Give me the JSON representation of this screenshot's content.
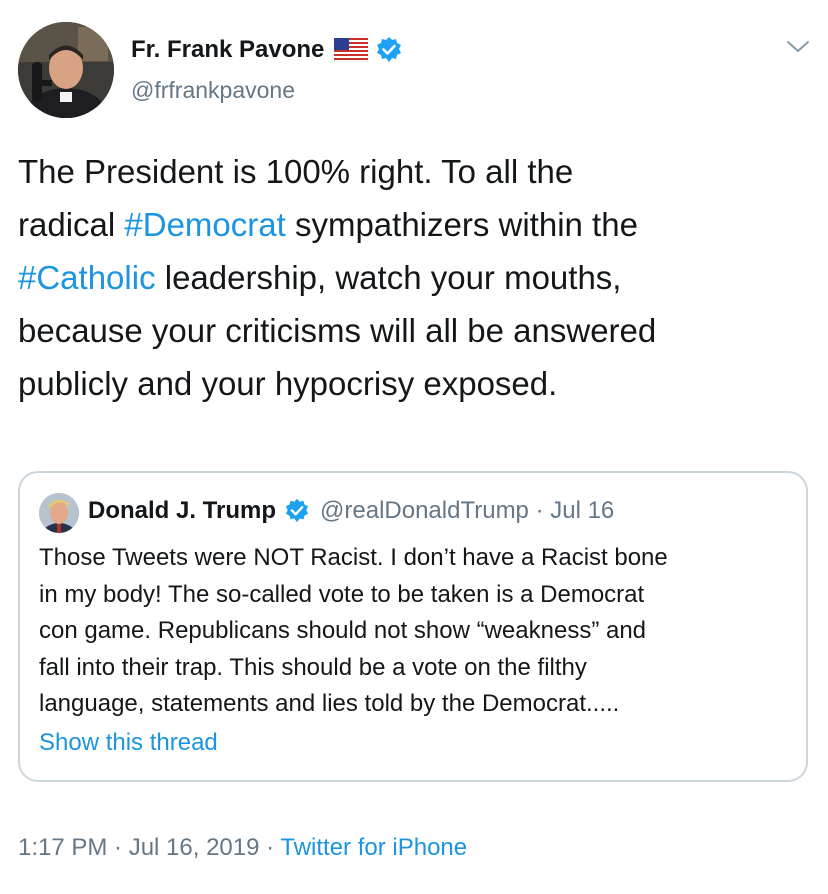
{
  "author": {
    "name": "Fr. Frank Pavone",
    "handle": "@frfrankpavone"
  },
  "icons": {
    "flag": "us-flag-icon",
    "verified": "verified-badge-icon",
    "menu": "chevron-down-icon"
  },
  "tweet": {
    "parts": [
      {
        "text": "The President is 100% right. To all the\nradical ",
        "type": "text"
      },
      {
        "text": "#Democrat",
        "type": "hashtag"
      },
      {
        "text": " sympathizers within the\n",
        "type": "text"
      },
      {
        "text": "#Catholic",
        "type": "hashtag"
      },
      {
        "text": " leadership, watch your mouths,\nbecause your criticisms will all be answered\npublicly and your hypocrisy exposed.",
        "type": "text"
      }
    ]
  },
  "quoted": {
    "name": "Donald J. Trump",
    "handle_date": "@realDonaldTrump · Jul 16",
    "text": "Those Tweets were NOT Racist. I don’t have a Racist bone\nin my body! The so-called vote to be taken is a Democrat\ncon game. Republicans should not show “weakness” and\nfall into their trap. This should be a vote on the filthy\nlanguage, statements and lies told by the Democrat.....",
    "thread_link": "Show this thread"
  },
  "meta": {
    "timestamp": "1:17 PM · Jul 16, 2019 · ",
    "source": "Twitter for iPhone"
  },
  "colors": {
    "link": "#1b95e0",
    "secondary": "#657786",
    "border": "#ccd6dd"
  }
}
